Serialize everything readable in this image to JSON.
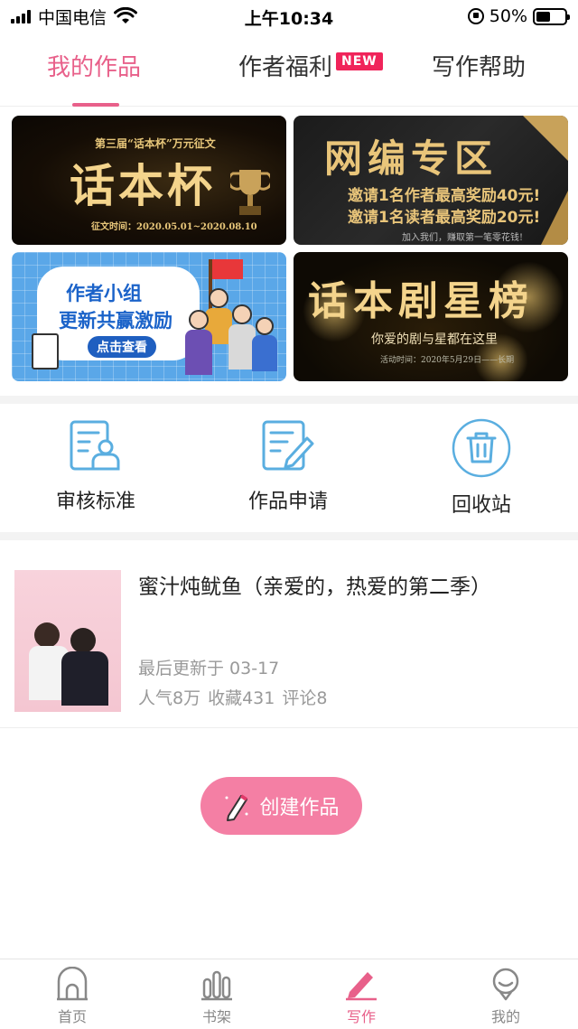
{
  "status_bar": {
    "carrier": "中国电信",
    "time": "上午10:34",
    "battery_percent": "50%",
    "battery_level": 0.5
  },
  "top_tabs": {
    "items": [
      {
        "label": "我的作品",
        "active": true
      },
      {
        "label": "作者福利",
        "active": false,
        "badge": "NEW"
      },
      {
        "label": "写作帮助",
        "active": false
      }
    ]
  },
  "banners": [
    {
      "name": "huabenbei",
      "subtitle": "第三届“话本杯”万元征文",
      "title": "话本杯",
      "footer": "征文时间：2020.05.01~2020.08.10"
    },
    {
      "name": "wangbian",
      "title": "网编专区",
      "line1": "邀请1名作者最高奖励40元!",
      "line2": "邀请1名读者最高奖励20元!",
      "footer": "加入我们，赚取第一笔零花钱!"
    },
    {
      "name": "author-group",
      "line1": "作者小组",
      "line2": "更新共赢激励",
      "button": "点击查看"
    },
    {
      "name": "drama-stars",
      "title": "话本剧星榜",
      "subtitle": "你爱的剧与星都在这里",
      "footer": "活动时间：2020年5月29日——长期"
    }
  ],
  "quick_actions": [
    {
      "label": "审核标准",
      "icon": "review-standard-icon"
    },
    {
      "label": "作品申请",
      "icon": "work-apply-icon"
    },
    {
      "label": "回收站",
      "icon": "trash-icon"
    }
  ],
  "work": {
    "title": "蜜汁炖鱿鱼（亲爱的，热爱的第二季）",
    "updated": "最后更新于 03-17",
    "popularity": "人气8万",
    "favorites": "收藏431",
    "comments": "评论8"
  },
  "create_button": {
    "label": "创建作品"
  },
  "bottom_nav": {
    "items": [
      {
        "label": "首页",
        "icon": "home-icon",
        "active": false
      },
      {
        "label": "书架",
        "icon": "bookshelf-icon",
        "active": false
      },
      {
        "label": "写作",
        "icon": "pencil-icon",
        "active": true
      },
      {
        "label": "我的",
        "icon": "profile-icon",
        "active": false
      }
    ]
  },
  "colors": {
    "accent": "#e8608a",
    "badge": "#f0245a",
    "create_button": "#f47fa4",
    "icon_blue": "#5aaee0"
  }
}
